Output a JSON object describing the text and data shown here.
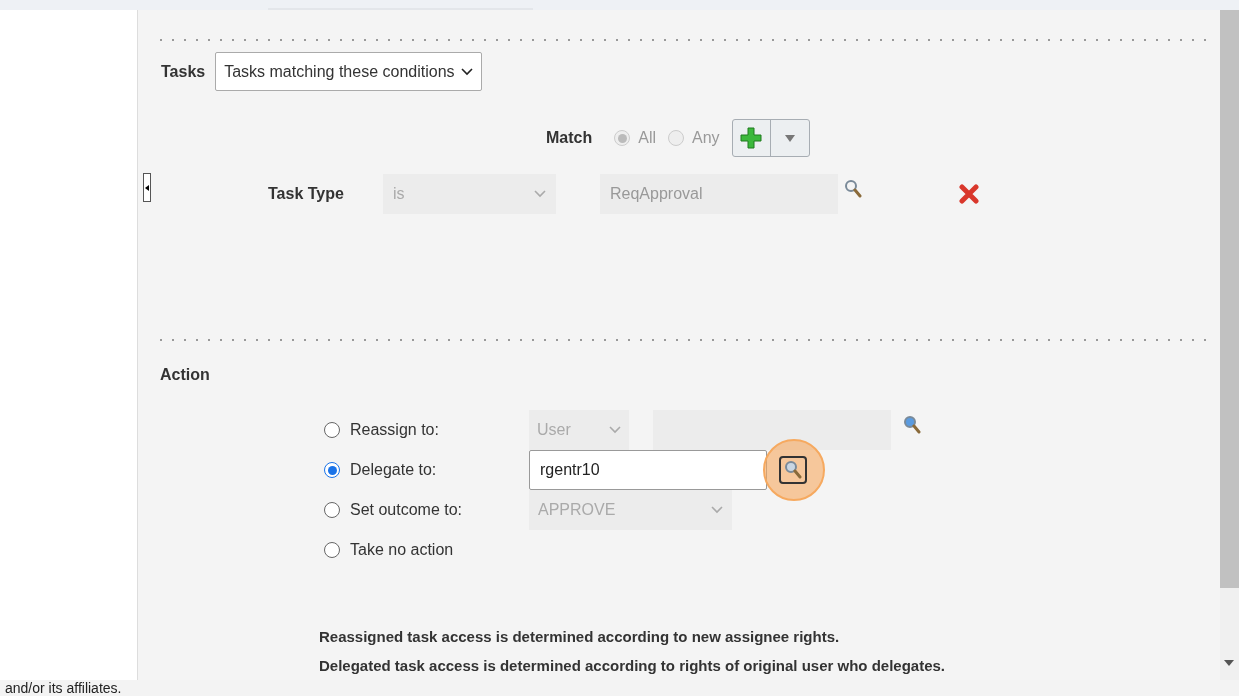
{
  "tasks": {
    "label": "Tasks",
    "value": "Tasks matching these conditions"
  },
  "match": {
    "label": "Match",
    "options": [
      {
        "label": "All",
        "selected": true,
        "disabled": true
      },
      {
        "label": "Any",
        "selected": false,
        "disabled": true
      }
    ]
  },
  "condition": {
    "label": "Task Type",
    "operator": "is",
    "value": "ReqApproval"
  },
  "action": {
    "label": "Action",
    "options": [
      {
        "label": "Reassign to:",
        "selected": false,
        "kind": "reassign",
        "select": "User"
      },
      {
        "label": "Delegate to:",
        "selected": true,
        "kind": "delegate",
        "value": "rgentr10"
      },
      {
        "label": "Set outcome to:",
        "selected": false,
        "kind": "outcome",
        "select": "APPROVE"
      },
      {
        "label": "Take no action",
        "selected": false,
        "kind": "none"
      }
    ]
  },
  "notes": [
    "Reassigned task access is determined according to new assignee rights.",
    "Delegated task access is determined according to rights of original user who delegates."
  ],
  "footer": "and/or its affiliates."
}
